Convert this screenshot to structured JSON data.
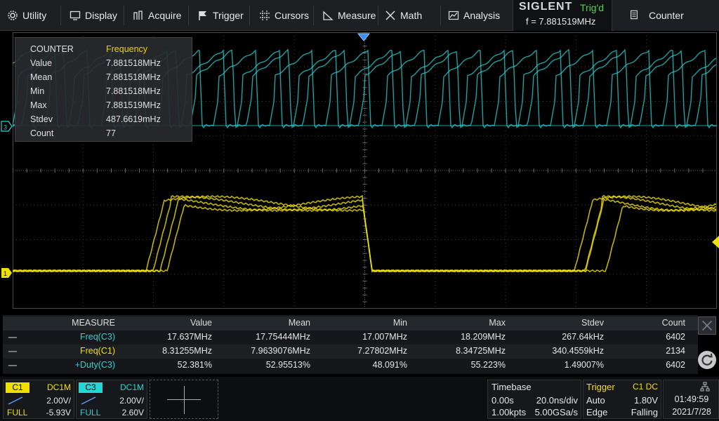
{
  "menu": {
    "utility": "Utility",
    "display": "Display",
    "acquire": "Acquire",
    "trigger": "Trigger",
    "cursors": "Cursors",
    "measure": "Measure",
    "math": "Math",
    "analysis": "Analysis"
  },
  "brand": "SIGLENT",
  "trig_state": "Trig'd",
  "freq_readout": "f = 7.881519MHz",
  "counter_button": "Counter",
  "counter_panel": {
    "title": "COUNTER",
    "mode": "Frequency",
    "rows": [
      {
        "key": "Value",
        "val": "7.881518MHz"
      },
      {
        "key": "Mean",
        "val": "7.881518MHz"
      },
      {
        "key": "Min",
        "val": "7.881518MHz"
      },
      {
        "key": "Max",
        "val": "7.881519MHz"
      },
      {
        "key": "Stdev",
        "val": "487.6619mHz"
      },
      {
        "key": "Count",
        "val": "77"
      }
    ]
  },
  "measure": {
    "headers": {
      "label": "MEASURE",
      "value": "Value",
      "mean": "Mean",
      "min": "Min",
      "max": "Max",
      "stdev": "Stdev",
      "count": "Count"
    },
    "rows": [
      {
        "label": "Freq(C3)",
        "value": "17.637MHz",
        "mean": "17.75444MHz",
        "min": "17.007MHz",
        "max": "18.209MHz",
        "stdev": "267.64kHz",
        "count": "6402"
      },
      {
        "label": "Freq(C1)",
        "value": "8.31255MHz",
        "mean": "7.9639076MHz",
        "min": "7.27802MHz",
        "max": "8.34725MHz",
        "stdev": "340.4559kHz",
        "count": "2134"
      },
      {
        "label": "+Duty(C3)",
        "value": "52.381%",
        "mean": "52.95513%",
        "min": "48.091%",
        "max": "55.223%",
        "stdev": "1.49007%",
        "count": "6402"
      }
    ]
  },
  "channels": {
    "c1": {
      "tag": "C1",
      "coupling": "DC1M",
      "scale": "2.00V/",
      "bw": "FULL",
      "offset": "-5.93V",
      "color": "#f0e000"
    },
    "c3": {
      "tag": "C3",
      "coupling": "DC1M",
      "scale": "2.00V/",
      "bw": "FULL",
      "offset": "2.60V",
      "color": "#27d5d5"
    }
  },
  "timebase": {
    "title": "Timebase",
    "delay": "0.00s",
    "scale": "20.0ns/div",
    "points": "1.00kpts",
    "rate": "5.00GSa/s"
  },
  "trigger": {
    "title": "Trigger",
    "source": "C1 DC",
    "mode": "Auto",
    "level": "1.80V",
    "type": "Edge",
    "slope": "Falling"
  },
  "clock": {
    "time": "01:49:59",
    "date": "2021/7/28"
  },
  "colors": {
    "accent_yellow": "#f0e000",
    "accent_cyan": "#27d5d5",
    "trig_green": "#4fd34f",
    "counter_mode": "#f5d000"
  },
  "markers": {
    "c1_ground": "1",
    "c3_ground": "3"
  }
}
